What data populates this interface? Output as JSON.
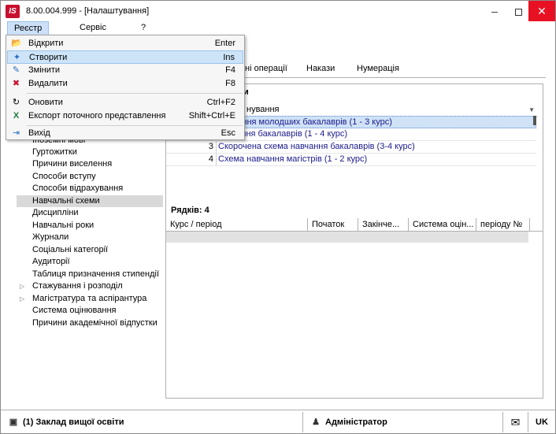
{
  "window": {
    "title": "8.00.004.999 - [Налаштування]",
    "app_icon_text": "IS"
  },
  "menubar": {
    "items": [
      {
        "label": "Реєстр"
      },
      {
        "label": "Сервіс"
      },
      {
        "label": "?"
      }
    ]
  },
  "dropdown": {
    "items": [
      {
        "label": "Відкрити",
        "shortcut": "Enter",
        "icon": "open-icon"
      },
      {
        "label": "Створити",
        "shortcut": "Ins",
        "icon": "create-icon"
      },
      {
        "label": "Змінити",
        "shortcut": "F4",
        "icon": "edit-icon"
      },
      {
        "label": "Видалити",
        "shortcut": "F8",
        "icon": "delete-icon"
      },
      {
        "label": "Оновити",
        "shortcut": "Ctrl+F2",
        "icon": "refresh-icon"
      },
      {
        "label": "Експорт поточного представлення",
        "shortcut": "Shift+Ctrl+E",
        "icon": "excel-export-icon"
      },
      {
        "label": "Вихід",
        "shortcut": "Esc",
        "icon": "exit-icon"
      }
    ]
  },
  "tabs": [
    {
      "label": "ні операції"
    },
    {
      "label": "Накази"
    },
    {
      "label": "Нумерація"
    }
  ],
  "group": {
    "title_fragment": "и"
  },
  "filter": {
    "value": "нування"
  },
  "schemes": [
    {
      "num": "",
      "name": "навчання молодших бакалаврів (1 - 3 курс)"
    },
    {
      "num": "",
      "name": "навчання бакалаврів (1 - 4  курс)"
    },
    {
      "num": "3",
      "name": "Скорочена схема навчання бакалаврів (3-4 курс)"
    },
    {
      "num": "4",
      "name": "Схема навчання магістрів (1 - 2 курс)"
    }
  ],
  "rows_count": "Рядків: 4",
  "grid2": {
    "columns": [
      "Курс / період",
      "Початок",
      "Закінче...",
      "Система оцін...",
      "періоду №"
    ]
  },
  "tree": {
    "items": [
      {
        "label": "Іноземні мові",
        "arrow": false,
        "selected": false
      },
      {
        "label": "Гуртожитки",
        "arrow": false,
        "selected": false
      },
      {
        "label": "Причини виселення",
        "arrow": false,
        "selected": false
      },
      {
        "label": "Способи вступу",
        "arrow": false,
        "selected": false
      },
      {
        "label": "Способи відрахування",
        "arrow": false,
        "selected": false
      },
      {
        "label": "Навчальні схеми",
        "arrow": false,
        "selected": true
      },
      {
        "label": "Дисципліни",
        "arrow": false,
        "selected": false
      },
      {
        "label": "Навчальні роки",
        "arrow": false,
        "selected": false
      },
      {
        "label": "Журнали",
        "arrow": false,
        "selected": false
      },
      {
        "label": "Соціальні категорії",
        "arrow": false,
        "selected": false
      },
      {
        "label": "Аудиторії",
        "arrow": false,
        "selected": false
      },
      {
        "label": "Таблиця призначення стипендії",
        "arrow": false,
        "selected": false
      },
      {
        "label": "Стажування і розподіл",
        "arrow": true,
        "selected": false
      },
      {
        "label": "Магістратура та аспірантура",
        "arrow": true,
        "selected": false
      },
      {
        "label": "Система оцінювання",
        "arrow": false,
        "selected": false
      },
      {
        "label": "Причини академічної відпустки",
        "arrow": false,
        "selected": false
      }
    ]
  },
  "statusbar": {
    "org": "(1) Заклад вищої освіти",
    "user": "Адміністратор",
    "lang": "UK"
  }
}
